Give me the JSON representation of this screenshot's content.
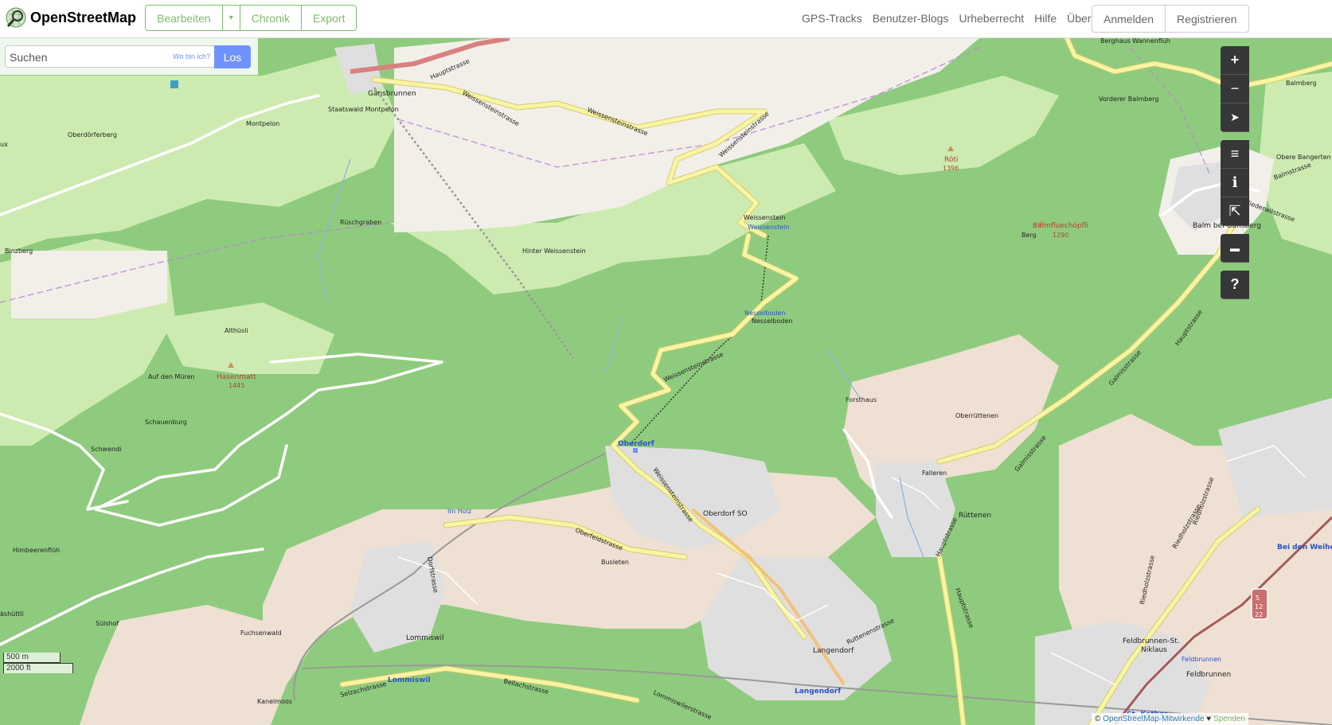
{
  "header": {
    "logo_title": "OpenStreetMap",
    "edit_label": "Bearbeiten",
    "history_label": "Chronik",
    "export_label": "Export",
    "nav": [
      "GPS-Tracks",
      "Benutzer-Blogs",
      "Urheberrecht",
      "Hilfe",
      "Über"
    ],
    "login_label": "Anmelden",
    "register_label": "Registrieren"
  },
  "search": {
    "placeholder": "Suchen",
    "whereami_label": "Wo bin ich?",
    "go_label": "Los"
  },
  "controls": {
    "zoom_in": "+",
    "zoom_out": "−",
    "locate": "➤",
    "layers": "≡",
    "info": "ℹ",
    "share": "⇱",
    "note": "▬",
    "query": "?"
  },
  "scale": {
    "metric": "500 m",
    "imperial": "2000 ft"
  },
  "attribution": {
    "prefix": "© ",
    "link": "OpenStreetMap-Mitwirkende",
    "heart": "♥",
    "donate": "Spenden"
  },
  "colors": {
    "forest": "#8fcb7e",
    "meadow": "#cdebb0",
    "residential": "#e0dfdf",
    "farmland": "#eee0d2",
    "road_yellow": "#f7f5a5",
    "road_white": "#ffffff",
    "accent": "#7ebc6f"
  },
  "map_labels": {
    "gaensbrunnen": "Gänsbrunnen",
    "staatswald": "Staatswald Montpelon",
    "montpelon": "Montpelon",
    "oberdoerferberg": "Oberdörferberg",
    "binzberg": "Binzberg",
    "rueschgraben": "Rüschgraben",
    "hinter_weissenstein": "Hinter Weissenstein",
    "weissenstein": "Weissenstein",
    "weissenstein_station": "Weissenstein",
    "nesselboden": "Nesselboden",
    "nesselboden_station": "Nesselboden",
    "althuesli": "Althüsli",
    "auf_den_mueren": "Auf den Müren",
    "hasenmatt": "Hasenmatt",
    "hasenmatt_ele": "1445",
    "schauenburg": "Schauenburg",
    "schwendi": "Schwendi",
    "himbeerenflueh": "Himbeerenflüh",
    "suelshof": "Sülshof",
    "aeshuettli": "äshüttli",
    "fuchsenwald": "Fuchsenwald",
    "kanelmoos": "Kanelmoos",
    "lommiswil": "Lommiswil",
    "lommiswil_station": "Lommiswil",
    "im_holz": "Im Holz",
    "busleten": "Busleten",
    "oberdorf": "Oberdorf",
    "oberdorf_so": "Oberdorf SO",
    "langendorf": "Langendorf",
    "langendorf_station": "Langendorf",
    "forsthaus": "Forsthaus",
    "oberruettenen": "Oberrüttenen",
    "falleren": "Falleren",
    "ruettenen": "Rüttenen",
    "balm_bei_guensberg": "Balm bei Günsberg",
    "balmfluechoepfli": "Balmfluechöpfli",
    "balmfluechoepfli_ele": "1290",
    "berg": "Berg",
    "roeti": "Röti",
    "roeti_ele": "1396",
    "vorderer_balmberg": "Vorderer Balmberg",
    "berghaus": "Berghaus Wannenflüh",
    "balmberg": "Balmberg",
    "obere_bangerten": "Obere Bangerten",
    "feldbrunnen_st_niklaus_1": "Feldbrunnen-St.",
    "feldbrunnen_st_niklaus_2": "Niklaus",
    "feldbrunnen": "Feldbrunnen",
    "feldbrunnen_station": "Feldbrunnen",
    "bei_den_weihern": "Bei den Weihe",
    "st_kathar": "St. Kathar",
    "ux": "ux",
    "hauptstrasse_1": "Hauptstrasse",
    "weissensteinstrasse_1": "Weissensteinstrasse",
    "weissensteinstrasse_2": "Weissensteinstrasse",
    "weissensteinstrasse_3": "Weissensteinstrasse",
    "weissensteinstrasse_4": "Weissensteinstrasse",
    "weissensteinstrasse_5": "Weissensteinstrasse",
    "oberfeldstrasse": "Oberfeldstrasse",
    "dorfstrasse": "Dorfstrasse",
    "selzachstrasse": "Selzachstrasse",
    "bellachstrasse": "Bellachstrasse",
    "lommiswilerstrasse": "Lommiswilerstrasse",
    "ruttenenstrasse": "Ruttenenstrasse",
    "hauptstrasse_2": "Hauptstrasse",
    "hauptstrasse_3": "Hauptstrasse",
    "hauptstrasse_4": "Hauptstrasse",
    "galmisstrasse_1": "Galmisstrasse",
    "galmisstrasse_2": "Galmisstrasse",
    "niederwilstrasse": "Niederwilstrasse",
    "balmstrasse": "Balmstrasse",
    "riedholzstrasse_1": "Riedholzstrasse",
    "riedholzstrasse_2": "Riedholzstrasse",
    "riedholzstrasse_3": "Riedholzstrasse",
    "route_shield": "5\n12\n22"
  }
}
